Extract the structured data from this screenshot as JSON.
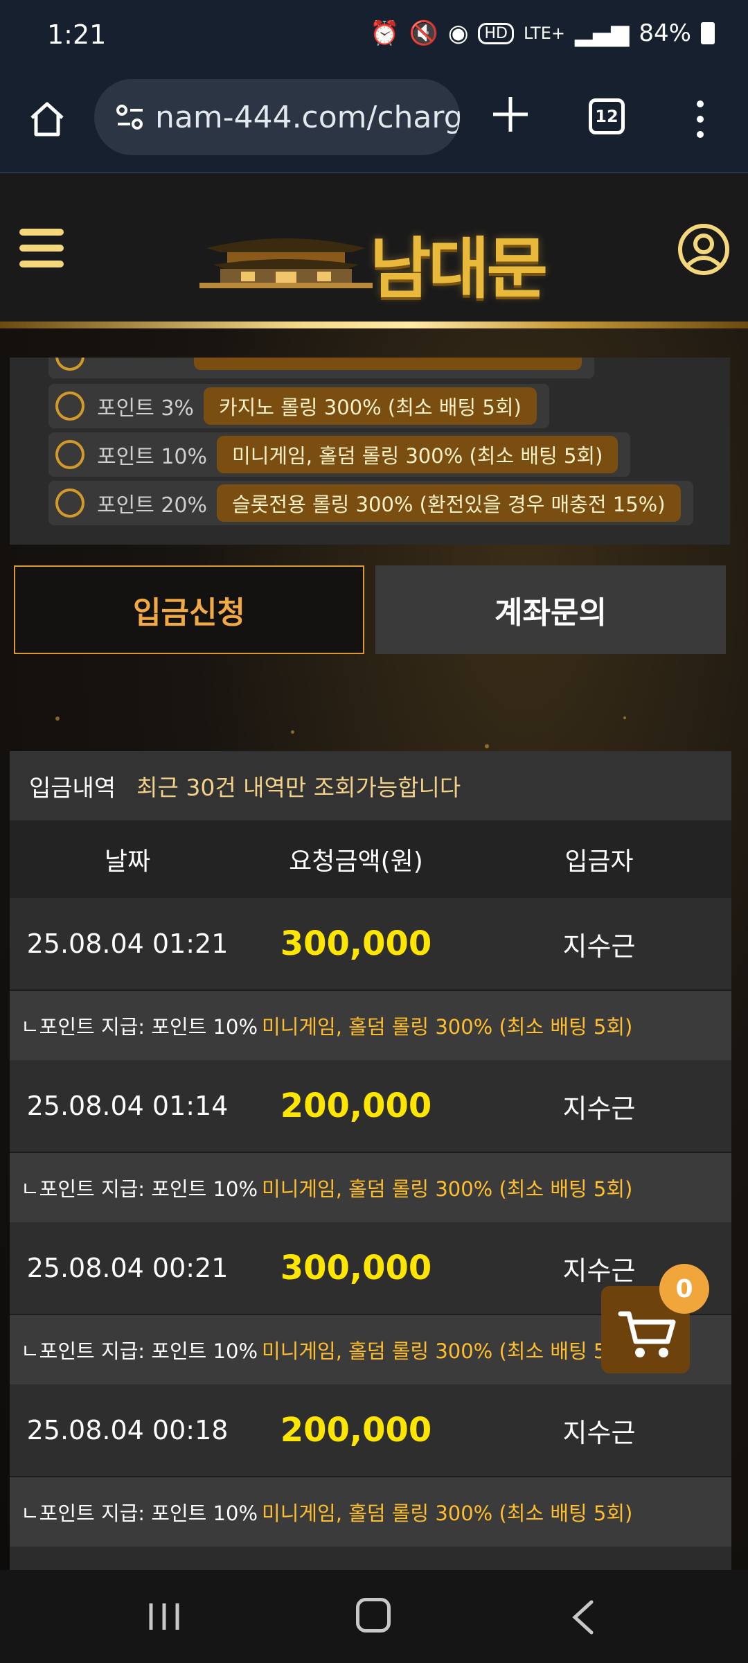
{
  "status_bar": {
    "time": "1:21",
    "network": "LTE+",
    "battery": "84%"
  },
  "browser": {
    "url": "nam-444.com/charg",
    "tab_count": "12"
  },
  "site": {
    "logo_text": "남대문"
  },
  "point_options": [
    {
      "label": "포인트 3%",
      "tag": "카지노 롤링 300% (최소 배팅 5회)"
    },
    {
      "label": "포인트 10%",
      "tag": "미니게임, 홀덤 롤링 300% (최소 배팅 5회)"
    },
    {
      "label": "포인트 20%",
      "tag": "슬롯전용 롤링 300% (환전있을 경우 매충전 15%)"
    }
  ],
  "tabs": {
    "deposit": "입금신청",
    "account_inquiry": "계좌문의"
  },
  "history": {
    "title": "입금내역",
    "note": "최근 30건 내역만 조회가능합니다",
    "columns": [
      "날짜",
      "요청금액(원)",
      "입금자"
    ],
    "point_prefix": "ㄴ포인트 지급: 포인트 10%",
    "point_value": "미니게임, 홀덤 롤링 300% (최소 배팅 5회)",
    "rows": [
      {
        "date": "25.08.04 01:21",
        "amount": "300,000",
        "depositor": "지수근"
      },
      {
        "date": "25.08.04 01:14",
        "amount": "200,000",
        "depositor": "지수근"
      },
      {
        "date": "25.08.04 00:21",
        "amount": "300,000",
        "depositor": "지수근"
      },
      {
        "date": "25.08.04 00:18",
        "amount": "200,000",
        "depositor": "지수근"
      }
    ]
  },
  "cart": {
    "count": "0"
  }
}
